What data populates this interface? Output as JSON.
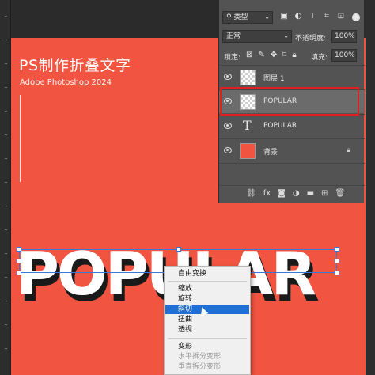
{
  "canvas": {
    "title": "PS制作折叠文字",
    "subtitle": "Adobe Photoshop 2024",
    "word": "POPULAR",
    "background_color": "#f15440"
  },
  "layers_panel": {
    "filter_label": "类型",
    "filter_icons": [
      "image-filter-icon",
      "adjustment-filter-icon",
      "type-filter-icon",
      "shape-filter-icon",
      "smart-object-filter-icon"
    ],
    "blend_mode": "正常",
    "opacity_label": "不透明度:",
    "opacity_value": "100%",
    "lock_label": "锁定:",
    "fill_label": "填充:",
    "fill_value": "100%",
    "layers": [
      {
        "name": "图层 1",
        "kind": "pixel"
      },
      {
        "name": "POPULAR",
        "kind": "pixel",
        "selected": true
      },
      {
        "name": "POPULAR",
        "kind": "text"
      },
      {
        "name": "背景",
        "kind": "background",
        "locked": true
      }
    ],
    "bottom_icons": [
      "link-icon",
      "fx-icon",
      "mask-icon",
      "adjustment-icon",
      "folder-icon",
      "new-layer-icon",
      "trash-icon"
    ]
  },
  "context_menu": {
    "items": [
      {
        "label": "自由变换",
        "state": "normal"
      },
      {
        "label": "缩放",
        "state": "normal"
      },
      {
        "label": "旋转",
        "state": "normal"
      },
      {
        "label": "斜切",
        "state": "selected"
      },
      {
        "label": "扭曲",
        "state": "normal"
      },
      {
        "label": "透视",
        "state": "normal"
      },
      {
        "label": "变形",
        "state": "normal"
      },
      {
        "label": "水平拆分变形",
        "state": "disabled"
      },
      {
        "label": "垂直拆分变形",
        "state": "disabled"
      }
    ]
  }
}
